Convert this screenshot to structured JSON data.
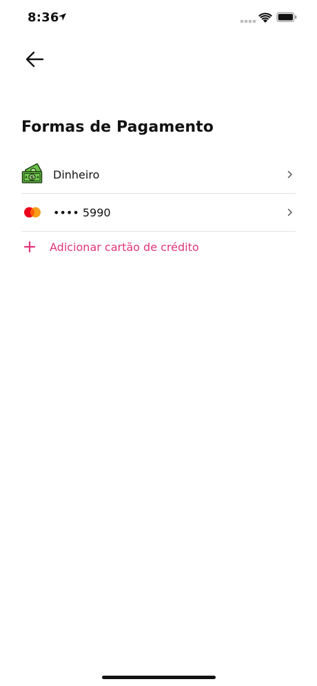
{
  "status_bar": {
    "time": "8:36"
  },
  "header": {
    "title": "Formas de Pagamento"
  },
  "payment_methods": [
    {
      "label": "Dinheiro",
      "icon": "cash-icon"
    },
    {
      "label": "•••• 5990",
      "icon": "mastercard-icon"
    }
  ],
  "add_card": {
    "label": "Adicionar cartão de crédito",
    "icon": "plus-icon"
  },
  "colors": {
    "accent": "#e0347a",
    "divider": "#e1e1e1",
    "text": "#111111"
  }
}
